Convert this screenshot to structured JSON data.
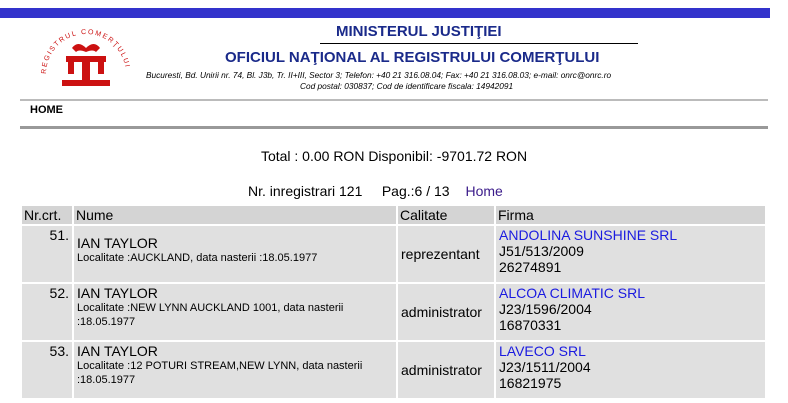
{
  "header": {
    "ministry": "MINISTERUL JUSTIŢIEI",
    "office": "OFICIUL NAŢIONAL AL REGISTRULUI COMERŢULUI",
    "address_line1": "Bucuresti, Bd. Unirii nr. 74, Bl. J3b, Tr. II+III, Sector 3; Telefon: +40 21 316.08.04; Fax: +40 21 316.08.03; e-mail: onrc@onrc.ro",
    "address_line2": "Cod postal: 030837; Cod de identificare fiscala: 14942091",
    "logo_text": "REGISTRUL COMERŢULUI",
    "accent_color": "#3333cc",
    "title_color": "#1a2a8a"
  },
  "nav": {
    "home": "HOME"
  },
  "summary": {
    "total": "Total : 0.00 RON Disponibil: -9701.72 RON"
  },
  "pager": {
    "count": "Nr. inregistrari 121",
    "page": "Pag.:6 / 13",
    "home": "Home"
  },
  "table": {
    "headers": [
      "Nr.crt.",
      "Nume",
      "Calitate",
      "Firma"
    ],
    "rows": [
      {
        "nr": "51.",
        "name": "IAN TAYLOR",
        "details": "Localitate :AUCKLAND, data nasterii :18.05.1977",
        "calitate": "reprezentant",
        "firma": "ANDOLINA SUNSHINE SRL",
        "reg": "J51/513/2009",
        "cui": "26274891"
      },
      {
        "nr": "52.",
        "name": "IAN TAYLOR",
        "details": "Localitate :NEW LYNN AUCKLAND 1001, data nasterii :18.05.1977",
        "calitate": "administrator",
        "firma": "ALCOA CLIMATIC SRL",
        "reg": "J23/1596/2004",
        "cui": "16870331"
      },
      {
        "nr": "53.",
        "name": "IAN TAYLOR",
        "details": "Localitate :12 POTURI STREAM,NEW LYNN, data nasterii :18.05.1977",
        "calitate": "administrator",
        "firma": "LAVECO SRL",
        "reg": "J23/1511/2004",
        "cui": "16821975"
      }
    ]
  }
}
